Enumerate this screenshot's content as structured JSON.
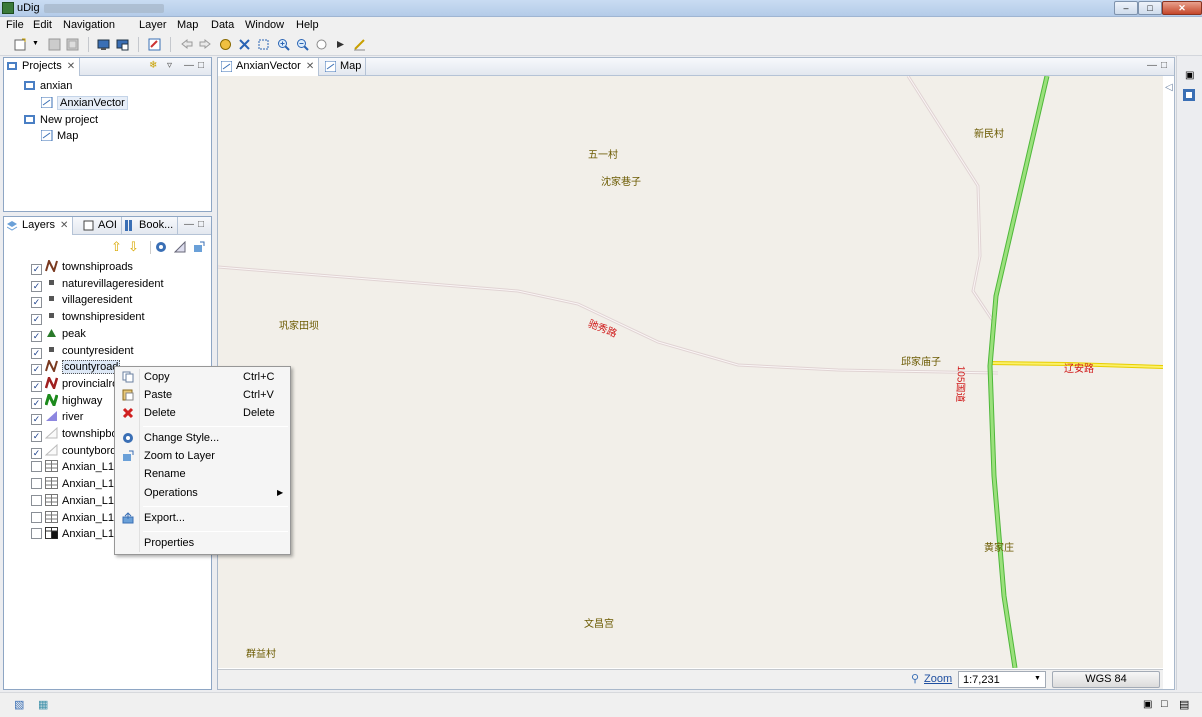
{
  "window": {
    "title": "uDig"
  },
  "menu": [
    "File",
    "Edit",
    "Navigation",
    "Layer",
    "Map",
    "Data",
    "Window",
    "Help"
  ],
  "projects_panel": {
    "tab_label": "Projects",
    "tree": [
      {
        "label": "anxian",
        "kind": "project"
      },
      {
        "label": "AnxianVector",
        "kind": "map",
        "selected": true
      },
      {
        "label": "New project",
        "kind": "project"
      },
      {
        "label": "Map",
        "kind": "map"
      }
    ]
  },
  "layers_panel": {
    "tabs": [
      "Layers",
      "AOI",
      "Book..."
    ],
    "layers": [
      {
        "name": "townshiproads",
        "checked": true,
        "icon": "line-brown-icon"
      },
      {
        "name": "naturevillageresident",
        "checked": true,
        "icon": "point-square-icon"
      },
      {
        "name": "villageresident",
        "checked": true,
        "icon": "point-square-icon"
      },
      {
        "name": "townshipresident",
        "checked": true,
        "icon": "point-square-icon"
      },
      {
        "name": "peak",
        "checked": true,
        "icon": "triangle-icon"
      },
      {
        "name": "countyresident",
        "checked": true,
        "icon": "point-square-icon"
      },
      {
        "name": "countyroad",
        "checked": true,
        "icon": "line-brown-icon",
        "selected": true
      },
      {
        "name": "provincialro",
        "checked": true,
        "icon": "line-red-icon"
      },
      {
        "name": "highway",
        "checked": true,
        "icon": "line-green-icon"
      },
      {
        "name": "river",
        "checked": true,
        "icon": "polygon-blue-icon"
      },
      {
        "name": "townshipbo",
        "checked": true,
        "icon": "polygon-outline-icon"
      },
      {
        "name": "countybord",
        "checked": true,
        "icon": "polygon-outline-icon"
      },
      {
        "name": "Anxian_L11",
        "checked": false,
        "icon": "grid-icon"
      },
      {
        "name": "Anxian_L12",
        "checked": false,
        "icon": "grid-icon"
      },
      {
        "name": "Anxian_L13",
        "checked": false,
        "icon": "grid-icon"
      },
      {
        "name": "Anxian_L14",
        "checked": false,
        "icon": "grid-icon"
      },
      {
        "name": "Anxian_L15",
        "checked": false,
        "icon": "grid-dark-icon"
      }
    ]
  },
  "editor_tabs": [
    {
      "label": "AnxianVector",
      "active": true
    },
    {
      "label": "Map",
      "active": false
    }
  ],
  "map_labels": [
    "五一村",
    "沈家巷子",
    "新民村",
    "巩家田坝",
    "邱家庙子",
    "辽安路",
    "黄家庄",
    "文昌宫",
    "群益村",
    "驰秀路",
    "105国道"
  ],
  "map_status": {
    "zoom_label": "Zoom",
    "scale": "1:7,231",
    "crs": "WGS 84"
  },
  "context_menu": {
    "copy": {
      "label": "Copy",
      "shortcut": "Ctrl+C"
    },
    "paste": {
      "label": "Paste",
      "shortcut": "Ctrl+V"
    },
    "delete": {
      "label": "Delete",
      "shortcut": "Delete"
    },
    "change_style": "Change Style...",
    "zoom_to_layer": "Zoom to Layer",
    "rename": "Rename",
    "operations": "Operations",
    "export": "Export...",
    "properties": "Properties"
  },
  "colors": {
    "highway": "#7ed957",
    "provincial": "#f4e04d",
    "road_label": "#d01818",
    "place_label": "#6b5a00",
    "map_bg": "#f2efe9"
  }
}
